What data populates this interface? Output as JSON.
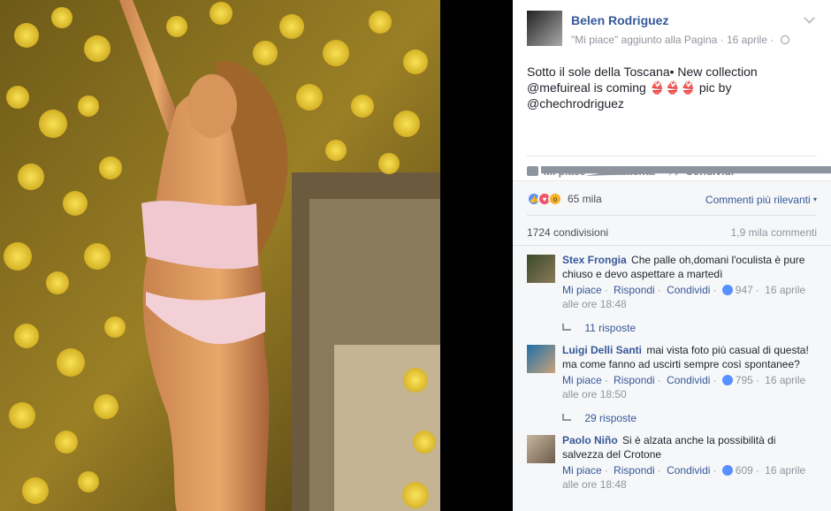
{
  "post": {
    "author": "Belen Rodriguez",
    "meta": "\"Mi piace\" aggiunto alla Pagina · 16 aprile ·",
    "text_line1": "Sotto il sole della Toscana• New collection",
    "text_line2": "@mefuireal is coming 👙👙👙 pic by",
    "text_line3": "@chechrodriguez"
  },
  "actions": {
    "like": "Mi piace",
    "comment": "Commenta",
    "share": "Condividi"
  },
  "feedback": {
    "reaction_count": "65 mila",
    "sort_label": "Commenti più rilevanti",
    "shares": "1724 condivisioni",
    "comments_count": "1,9 mila commenti"
  },
  "comments": [
    {
      "name": "Stex Frongia",
      "text": "Che palle oh,domani l'oculista è pure chiuso e devo aspettare a martedì",
      "like": "Mi piace",
      "reply": "Rispondi",
      "share": "Condividi",
      "likes": "947",
      "date": "16 aprile alle ore 18:48",
      "replies": "11 risposte"
    },
    {
      "name": "Luigi Delli Santi",
      "text": "mai vista foto più casual di questa! ma come fanno ad uscirti sempre così spontanee?",
      "like": "Mi piace",
      "reply": "Rispondi",
      "share": "Condividi",
      "likes": "795",
      "date": "16 aprile alle ore 18:50",
      "replies": "29 risposte"
    },
    {
      "name": "Paolo Niño",
      "text": "Si è alzata anche la possibilità di salvezza del Crotone",
      "like": "Mi piace",
      "reply": "Rispondi",
      "share": "Condividi",
      "likes": "609",
      "date": "16 aprile alle ore 18:48"
    }
  ],
  "colors": {
    "link": "#365899",
    "meta": "#90949c",
    "like_blue": "#5890ff"
  }
}
